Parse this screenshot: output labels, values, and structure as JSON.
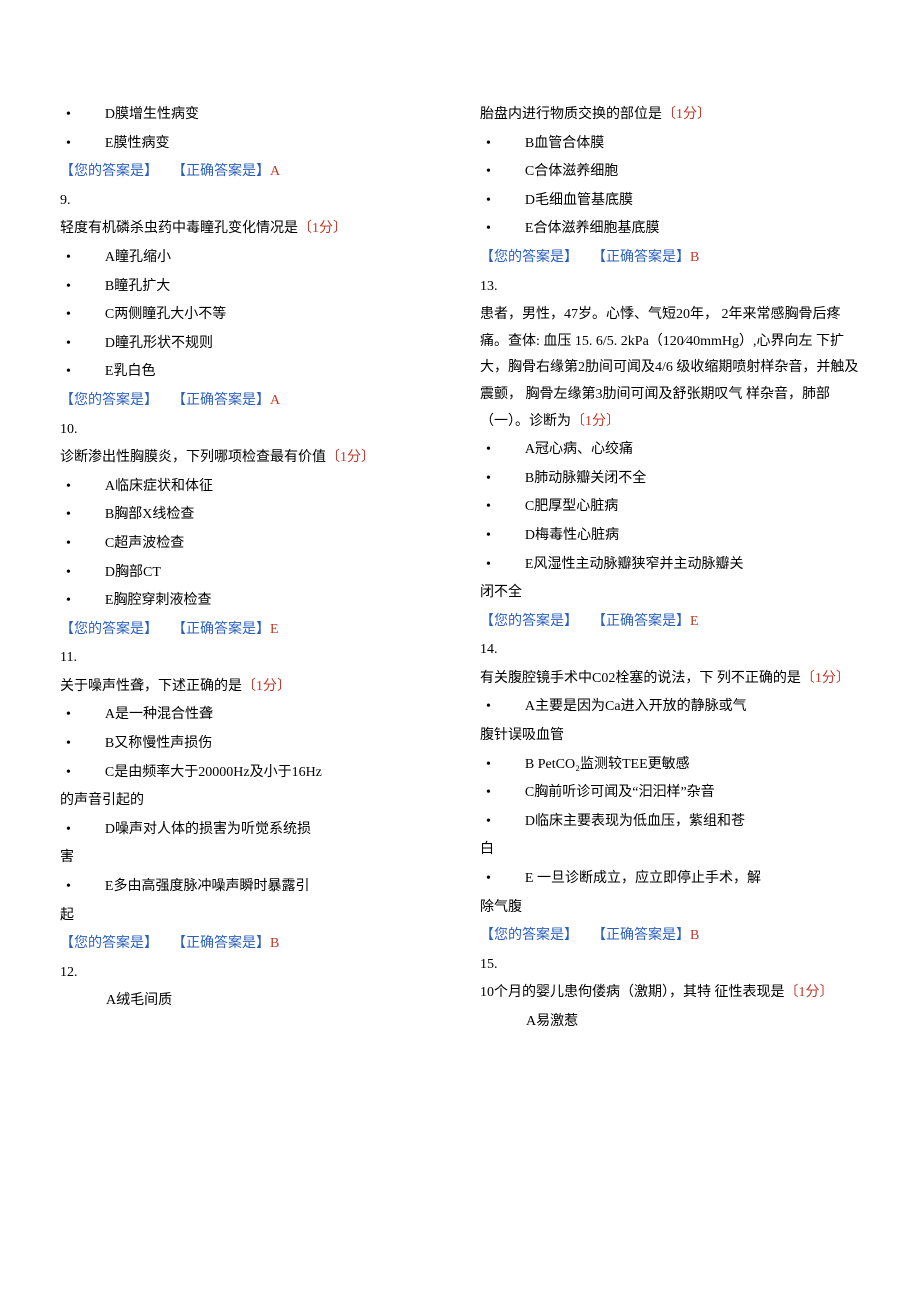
{
  "bullet": "•",
  "labels": {
    "your_answer": "【您的答案是】",
    "correct_answer": "【正确答案是】"
  },
  "left": {
    "q8": {
      "opts": [
        {
          "txt": "D膜增生性病变"
        },
        {
          "txt": "E膜性病变"
        }
      ],
      "correct": "A"
    },
    "q9": {
      "num": "9.",
      "stem": "轻度有机磷杀虫药中毒瞳孔变化情况是",
      "score": "〔1分〕",
      "opts": [
        {
          "txt": "A瞳孔缩小"
        },
        {
          "txt": "B瞳孔扩大"
        },
        {
          "txt": "C两侧瞳孔大小不等"
        },
        {
          "txt": "D瞳孔形状不规则"
        },
        {
          "txt": "E乳白色"
        }
      ],
      "correct": "A"
    },
    "q10": {
      "num": "10.",
      "stem": "诊断渗出性胸膜炎，下列哪项检查最有价值",
      "score": "〔1分〕",
      "opts": [
        {
          "txt": "A临床症状和体征"
        },
        {
          "txt": "B胸部X线检查"
        },
        {
          "txt": "C超声波检查"
        },
        {
          "txt": "D胸部CT"
        },
        {
          "txt": "E胸腔穿刺液检查"
        }
      ],
      "correct": "E"
    },
    "q11": {
      "num": "11.",
      "stem": "关于噪声性聋，下述正确的是",
      "score": "〔1分〕",
      "opts": [
        {
          "txt": "A是一种混合性聋"
        },
        {
          "txt": "B又称慢性声损伤"
        },
        {
          "txt": "C是由频率大于20000Hz及小于16Hz",
          "cont": "的声音引起的"
        },
        {
          "txt": "D噪声对人体的损害为听觉系统损",
          "cont": "害"
        },
        {
          "txt": "E多由高强度脉冲噪声瞬时暴露引",
          "cont": "起"
        }
      ],
      "correct": "B"
    },
    "q12": {
      "num": "12.",
      "optA": "A绒毛间质"
    }
  },
  "right": {
    "q12": {
      "stem": "胎盘内进行物质交换的部位是",
      "score": "〔1分〕",
      "opts": [
        {
          "txt": "B血管合体膜"
        },
        {
          "txt": "C合体滋养细胞"
        },
        {
          "txt": "D毛细血管基底膜"
        },
        {
          "txt": "E合体滋养细胞基底膜"
        }
      ],
      "correct": "B"
    },
    "q13": {
      "num": "13.",
      "stem": "患者，男性，47岁。心悸、气短20年， 2年来常感胸骨后疼痛。查体:  血压  15. 6/5. 2kPa（120⁄40mmHg）,心界向左  下扩大，胸骨右缘第2肋间可闻及4/6 级收缩期喷射样杂音，并触及震颤， 胸骨左缘第3肋间可闻及舒张期叹气 样杂音，肺部（一）。诊断为",
      "score": "〔1分〕",
      "opts": [
        {
          "txt": "A冠心病、心绞痛"
        },
        {
          "txt": "B肺动脉瓣关闭不全"
        },
        {
          "txt": "C肥厚型心脏病"
        },
        {
          "txt": "D梅毒性心脏病"
        },
        {
          "txt": "E风湿性主动脉瓣狭窄并主动脉瓣关",
          "cont": "闭不全"
        }
      ],
      "correct": "E"
    },
    "q14": {
      "num": "14.",
      "stem": "有关腹腔镜手术中C02栓塞的说法，下 列不正确的是",
      "score": "〔1分〕",
      "opts": [
        {
          "txt": "A主要是因为Ca进入开放的静脉或气",
          "cont": "腹针误吸血管"
        },
        {
          "txt": "B   PetCO₂监测较TEE更敏感"
        },
        {
          "txt": "C胸前听诊可闻及“汩汩样”杂音"
        },
        {
          "txt": "D临床主要表现为低血压，紫组和苍",
          "cont": "白"
        },
        {
          "txt": "E   一旦诊断成立，应立即停止手术，解",
          "cont": "除气腹"
        }
      ],
      "correct": "B"
    },
    "q15": {
      "num": "15.",
      "stem": "10个月的婴儿患佝偻病（激期），其特 征性表现是",
      "score": "〔1分〕",
      "optA": "A易激惹"
    }
  }
}
